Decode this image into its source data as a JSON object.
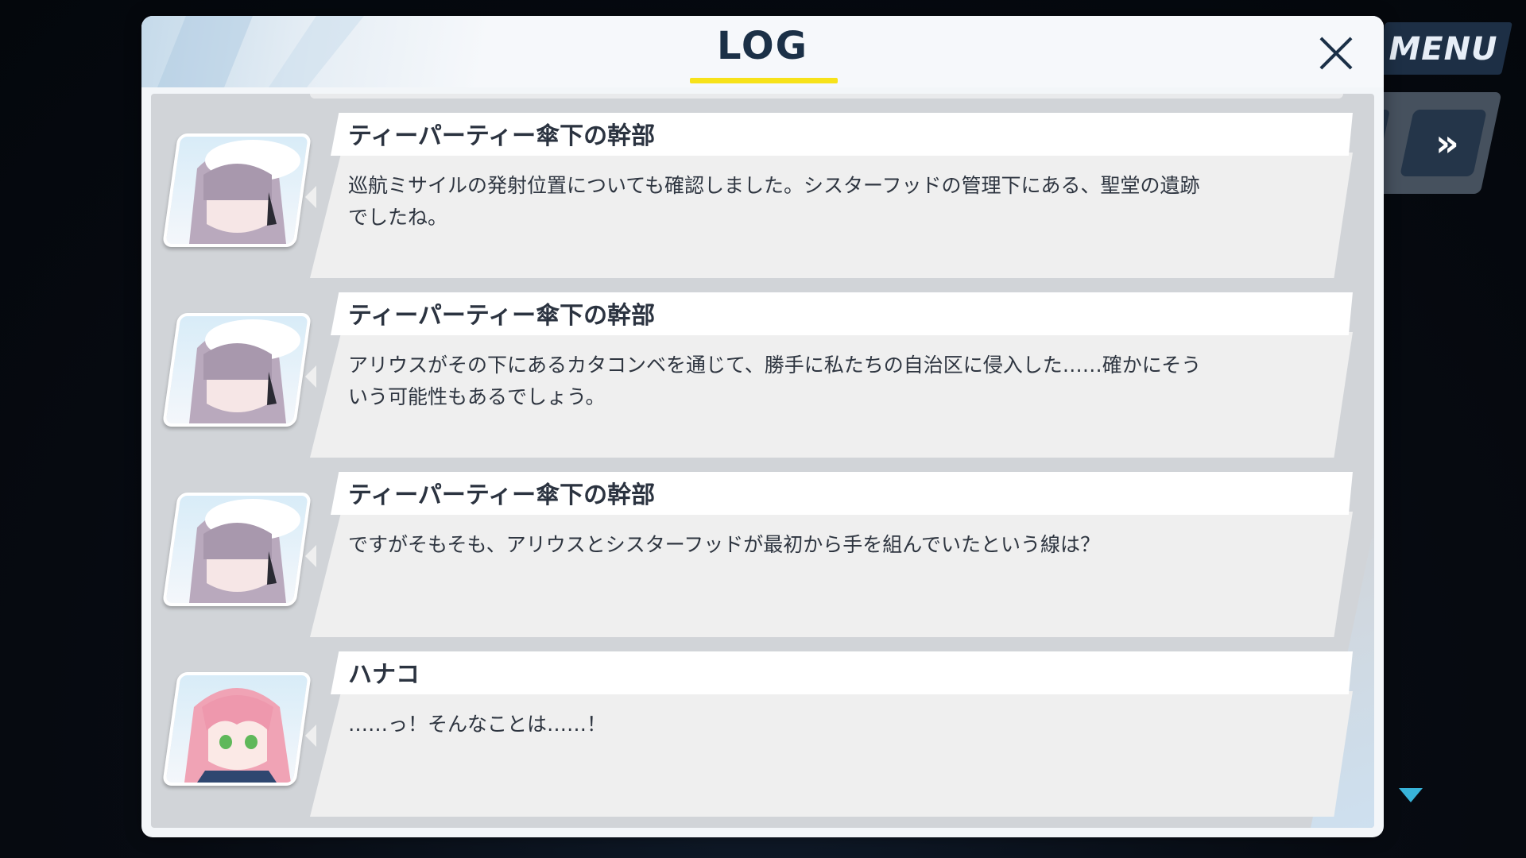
{
  "hud": {
    "menu_label": "MENU",
    "skip_label": "»"
  },
  "panel": {
    "title": "LOG",
    "accent_color": "#f7e21a",
    "close_icon": "close-icon"
  },
  "entries": [
    {
      "speaker": "ティーパーティー傘下の幹部",
      "text": "巡航ミサイルの発射位置についても確認しました。シスターフッドの管理下にある、聖堂の遺跡でしたね。",
      "portrait": "lavender-hair-beret-portrait"
    },
    {
      "speaker": "ティーパーティー傘下の幹部",
      "text": "アリウスがその下にあるカタコンベを通じて、勝手に私たちの自治区に侵入した……確かにそういう可能性もあるでしょう。",
      "portrait": "lavender-hair-beret-portrait"
    },
    {
      "speaker": "ティーパーティー傘下の幹部",
      "text": "ですがそもそも、アリウスとシスターフッドが最初から手を組んでいたという線は？",
      "portrait": "lavender-hair-beret-portrait"
    },
    {
      "speaker": "ハナコ",
      "text": "……っ！そんなことは……！",
      "portrait": "pink-hair-portrait"
    }
  ]
}
